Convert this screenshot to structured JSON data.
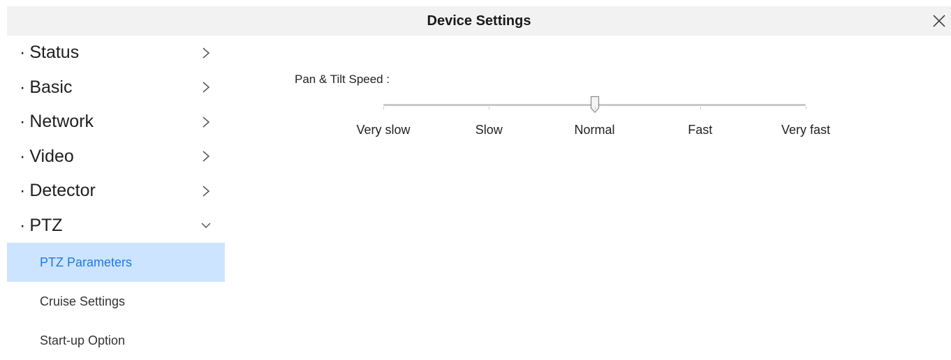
{
  "dialog": {
    "title": "Device Settings",
    "close_icon": "close-icon"
  },
  "sidebar": {
    "items": [
      {
        "label": "Status",
        "expanded": false
      },
      {
        "label": "Basic",
        "expanded": false
      },
      {
        "label": "Network",
        "expanded": false
      },
      {
        "label": "Video",
        "expanded": false
      },
      {
        "label": "Detector",
        "expanded": false
      },
      {
        "label": "PTZ",
        "expanded": true
      }
    ],
    "bullet": "·",
    "ptz_subitems": [
      {
        "label": "PTZ Parameters",
        "active": true
      },
      {
        "label": "Cruise Settings",
        "active": false
      },
      {
        "label": "Start-up Option",
        "active": false
      }
    ]
  },
  "ptz": {
    "speed_label": "Pan & Tilt Speed :",
    "speed_options": [
      "Very slow",
      "Slow",
      "Normal",
      "Fast",
      "Very fast"
    ],
    "selected_index": 2
  },
  "colors": {
    "titlebar_bg": "#f2f2f2",
    "active_bg": "#cce4ff",
    "active_text": "#1f7ae0",
    "track": "#c8c8c8"
  }
}
